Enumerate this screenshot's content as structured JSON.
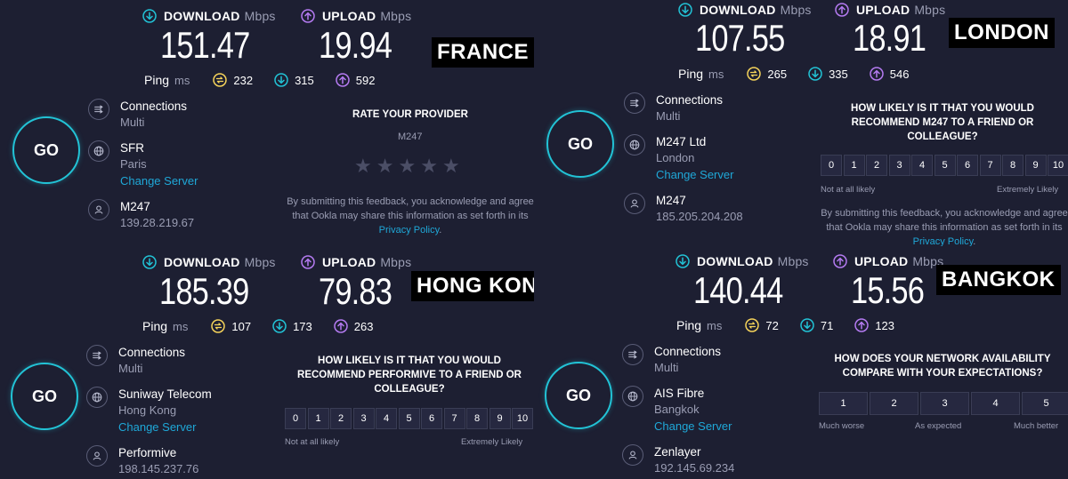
{
  "common": {
    "download_label": "DOWNLOAD",
    "upload_label": "UPLOAD",
    "unit": "Mbps",
    "ping_label": "Ping",
    "ping_unit": "ms",
    "go_label": "GO",
    "connections_label": "Connections",
    "connections_value": "Multi",
    "change_server": "Change Server",
    "privacy_link": "Privacy Policy",
    "disclaimer_text": "By submitting this feedback, you acknowledge and agree that Ookla may share this information as set forth in its",
    "disclaimer_end": ".",
    "not_likely": "Not at all likely",
    "extremely_likely": "Extremely Likely",
    "scale": [
      "0",
      "1",
      "2",
      "3",
      "4",
      "5",
      "6",
      "7",
      "8",
      "9",
      "10"
    ],
    "colors": {
      "download": "#22c3d6",
      "upload": "#b57bf2",
      "ping": "#f5d35a",
      "go_ring": "#22c3d6",
      "link": "#1fa8d8"
    }
  },
  "france": {
    "label": "FRANCE",
    "download": "151.47",
    "upload": "19.94",
    "ping": "232",
    "ping_down": "315",
    "ping_up": "592",
    "isp": "SFR",
    "location": "Paris",
    "host": "M247",
    "ip": "139.28.219.67",
    "question": "RATE YOUR PROVIDER",
    "provider": "M247"
  },
  "london": {
    "label": "LONDON",
    "download": "107.55",
    "upload": "18.91",
    "ping": "265",
    "ping_down": "335",
    "ping_up": "546",
    "isp": "M247 Ltd",
    "location": "London",
    "host": "M247",
    "ip": "185.205.204.208",
    "question": "HOW LIKELY IS IT THAT YOU WOULD RECOMMEND M247 TO A FRIEND OR COLLEAGUE?"
  },
  "hongkong": {
    "label": "HONG KONG",
    "download": "185.39",
    "upload": "79.83",
    "ping": "107",
    "ping_down": "173",
    "ping_up": "263",
    "isp": "Suniway Telecom",
    "location": "Hong Kong",
    "host": "Performive",
    "ip": "198.145.237.76",
    "question": "HOW LIKELY IS IT THAT YOU WOULD RECOMMEND PERFORMIVE TO A FRIEND OR COLLEAGUE?"
  },
  "bangkok": {
    "label": "BANGKOK",
    "download": "140.44",
    "upload": "15.56",
    "ping": "72",
    "ping_down": "71",
    "ping_up": "123",
    "isp": "AIS Fibre",
    "location": "Bangkok",
    "host": "Zenlayer",
    "ip": "192.145.69.234",
    "question": "HOW DOES YOUR NETWORK AVAILABILITY COMPARE WITH YOUR EXPECTATIONS?",
    "scale": [
      "1",
      "2",
      "3",
      "4",
      "5"
    ],
    "scale_notes": [
      "Much worse",
      "As expected",
      "Much better"
    ]
  }
}
